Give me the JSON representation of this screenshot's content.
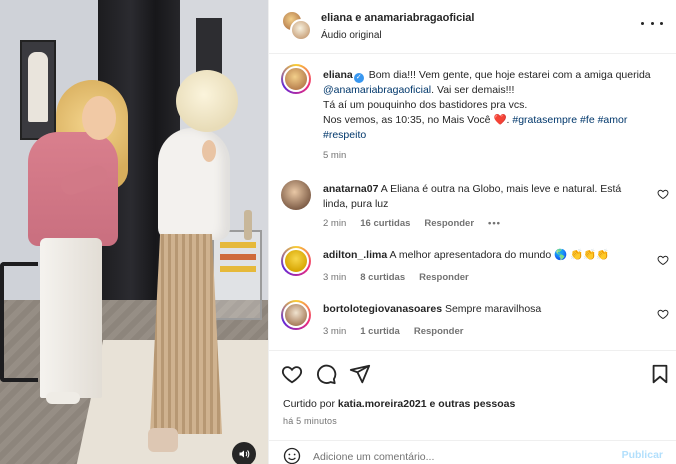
{
  "header": {
    "names": "eliana e anamariabragaoficial",
    "subtitle": "Áudio original"
  },
  "caption": {
    "username": "eliana",
    "text_1": "Bom dia!!! Vem gente, que hoje estarei com a amiga querida",
    "mention": "@anamariabragaoficial",
    "text_2": ". Vai ser demais!!!",
    "line_2": "Tá aí um pouquinho dos bastidores pra vcs.",
    "line_3": "Nos vemos, as 10:35, no Mais Você",
    "heart": "❤️",
    "hashtags": "#gratasempre #fe #amor #respeito",
    "time": "5 min"
  },
  "comments": [
    {
      "username": "anatarna07",
      "text": "A Eliana é outra na Globo, mais leve e natural. Está linda, pura luz",
      "time": "2 min",
      "likes": "16 curtidas",
      "reply": "Responder",
      "more": "•••"
    },
    {
      "username": "adilton_.lima",
      "text": "A melhor apresentadora do mundo 🌎 👏👏👏",
      "time": "3 min",
      "likes": "8 curtidas",
      "reply": "Responder"
    },
    {
      "username": "bortolotegiovanasoares",
      "text": "Sempre maravilhosa",
      "time": "3 min",
      "likes": "1 curtida",
      "reply": "Responder"
    }
  ],
  "liked_by": {
    "prefix": "Curtido por",
    "user": "katia.moreira2021",
    "suffix": "e outras pessoas"
  },
  "ago": "há 5 minutos",
  "composer": {
    "placeholder": "Adicione um comentário...",
    "publish": "Publicar"
  },
  "colors": {
    "link": "#00376b",
    "publish_disabled": "#b2dffc",
    "muted": "#737373"
  }
}
